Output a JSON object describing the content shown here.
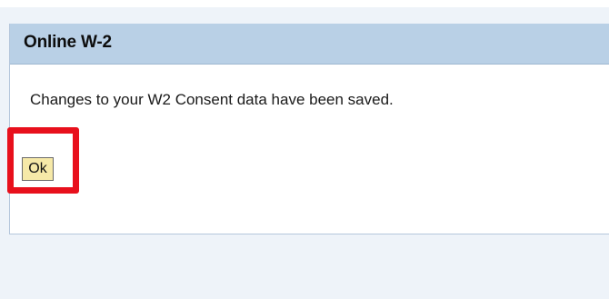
{
  "panel": {
    "title": "Online W-2",
    "message": "Changes to your W2 Consent data have been saved."
  },
  "actions": {
    "ok_label": "Ok"
  },
  "annotation": {
    "highlight_color": "#e8101c"
  },
  "colors": {
    "header_background": "#b9d0e6",
    "page_background": "#eef3f9",
    "button_background": "#f6e9a8"
  }
}
